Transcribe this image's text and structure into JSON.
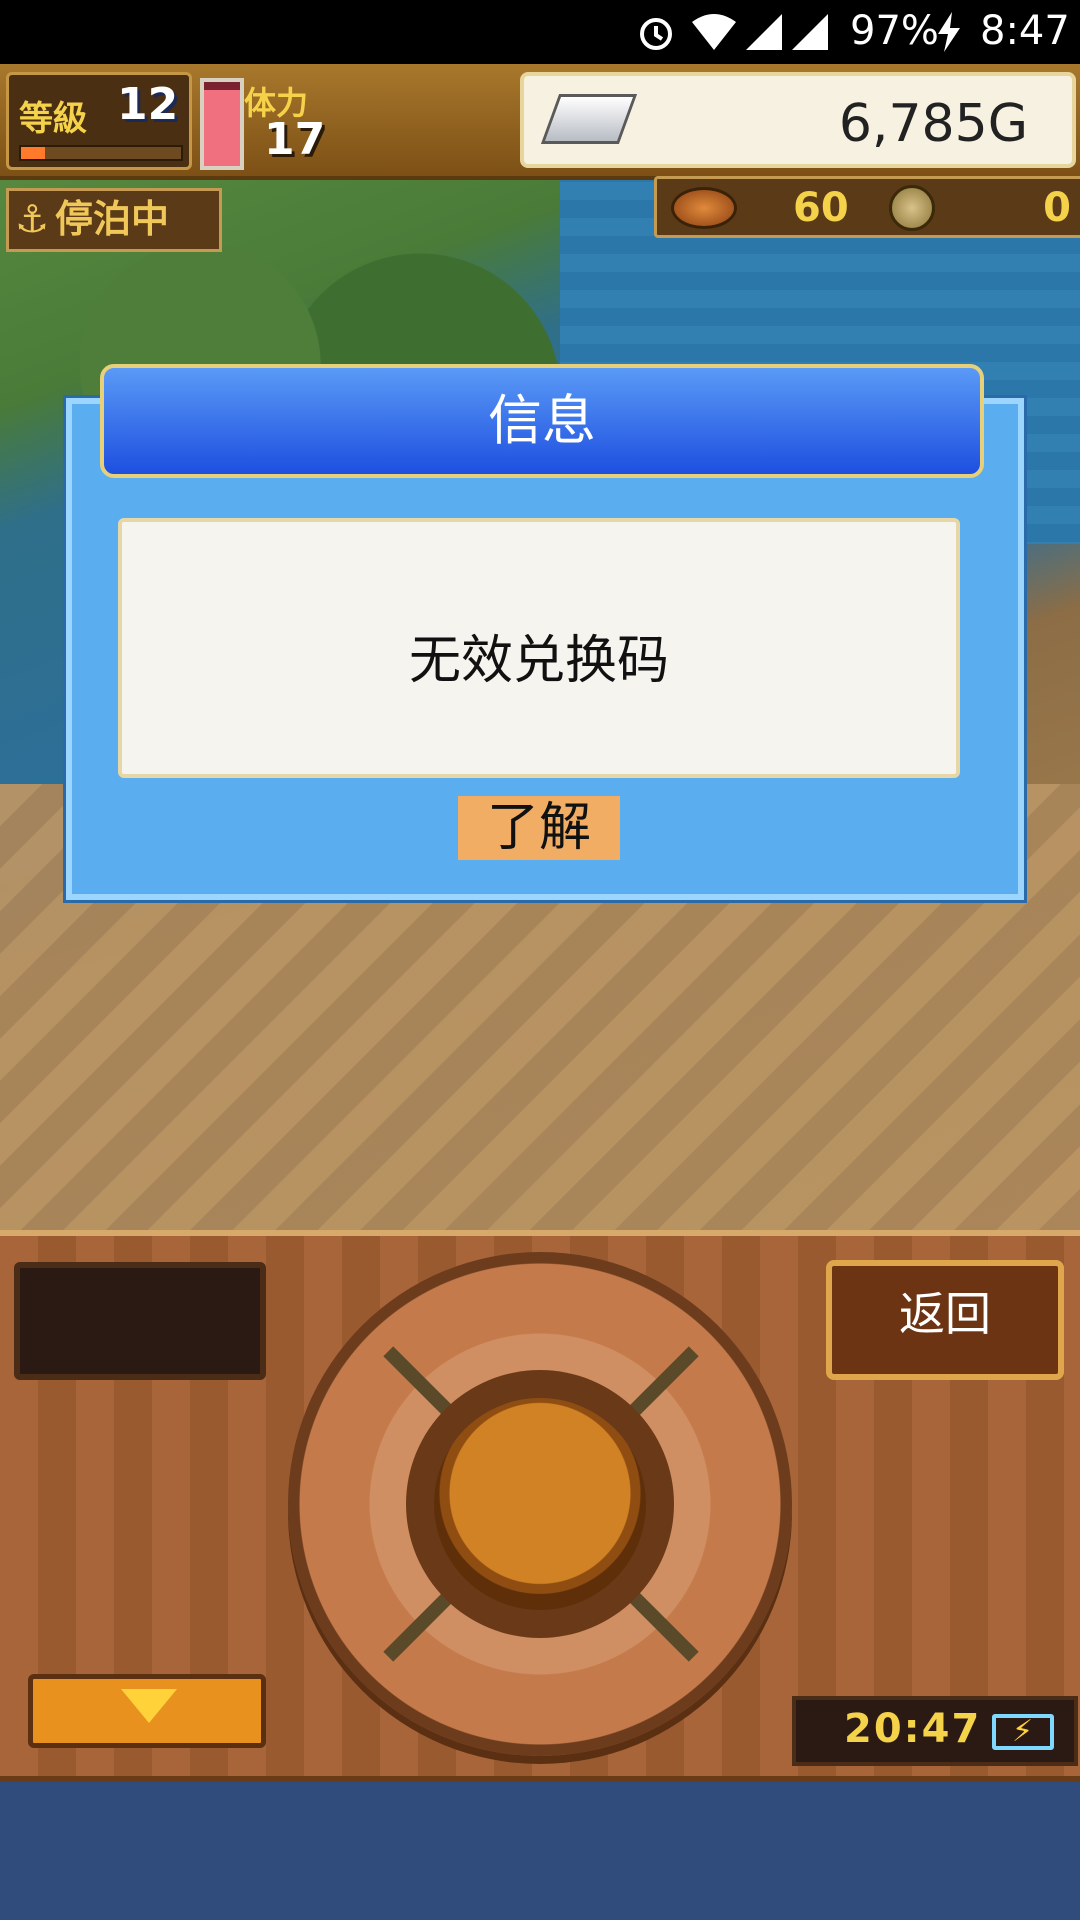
{
  "status_bar": {
    "battery": "97%",
    "time": "8:47",
    "icons": [
      "alarm-icon",
      "wifi-icon",
      "signal-icon",
      "signal-icon",
      "charging-icon"
    ]
  },
  "hud": {
    "level_label": "等級",
    "level": "12",
    "level_progress": 0.15,
    "stamina_label": "体力",
    "stamina": "17",
    "stamina_gauge_level": 0.9,
    "gold": "6,785G",
    "anchor_status": "停泊中",
    "food": "60",
    "coins": "0",
    "colors": {
      "accent": "#f4d24a",
      "dialog_blue": "#5aaef0",
      "header_blue": "#1e4fe0"
    }
  },
  "dialog": {
    "title": "信息",
    "message": "无效兑换码",
    "ok_label": "了解"
  },
  "panel": {
    "back_label": "返回",
    "clock": "20:47"
  }
}
